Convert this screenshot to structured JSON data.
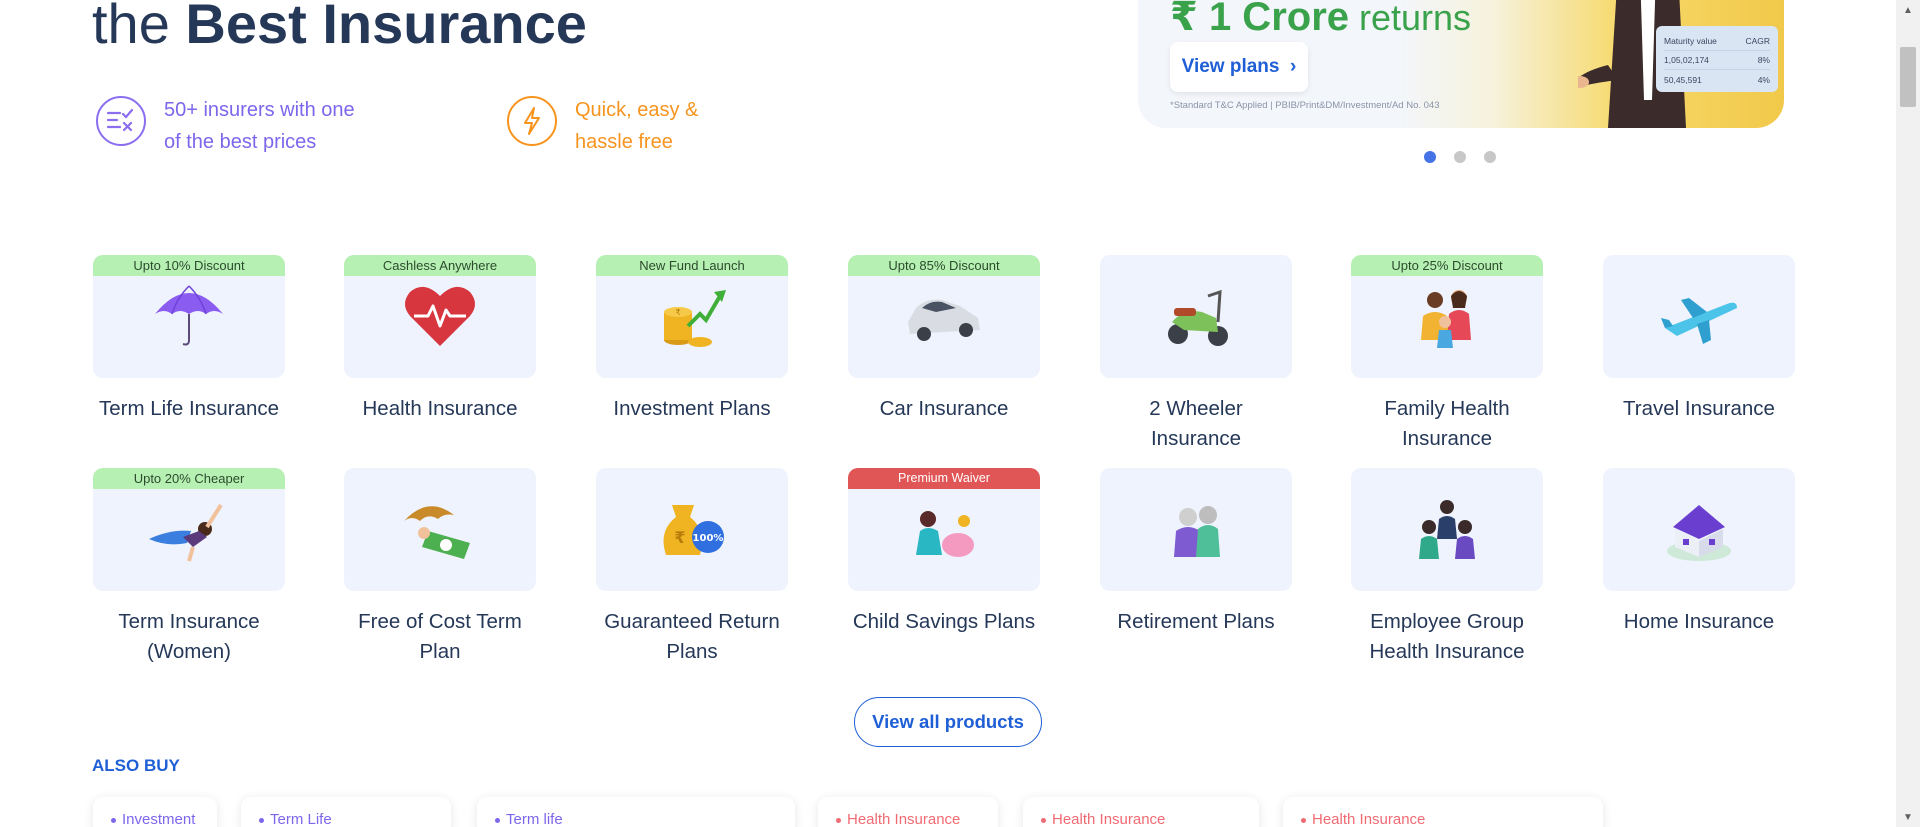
{
  "hero": {
    "title_prefix": "the ",
    "title_bold": "Best Insurance"
  },
  "features": [
    {
      "icon": "compare-check-icon",
      "line1": "50+ insurers with one",
      "line2": "of the best prices",
      "color": "#7e66ec"
    },
    {
      "icon": "lightning-icon",
      "line1": "Quick, easy &",
      "line2": "hassle free",
      "color": "#f7941d"
    }
  ],
  "banner": {
    "headline_bold": "₹ 1 Crore",
    "headline_rest": " returns",
    "button_label": "View plans",
    "button_arrow": "›",
    "note": "*Standard T&C Applied | PBIB/Print&DM/Investment/Ad No. 043",
    "table": {
      "headers": [
        "Maturity value",
        "CAGR"
      ],
      "rows": [
        [
          "1,05,02,174",
          "8%"
        ],
        [
          "50,45,591",
          "4%"
        ]
      ]
    }
  },
  "carousel": {
    "dots": 3,
    "active": 0
  },
  "products": [
    {
      "label": "Term Life Insurance",
      "tag": "Upto 10% Discount",
      "icon": "umbrella-icon"
    },
    {
      "label": "Health Insurance",
      "tag": "Cashless Anywhere",
      "icon": "heart-pulse-icon"
    },
    {
      "label": "Investment Plans",
      "tag": "New Fund Launch",
      "icon": "coins-growth-icon"
    },
    {
      "label": "Car Insurance",
      "tag": "Upto 85% Discount",
      "icon": "car-icon"
    },
    {
      "label": "2 Wheeler Insurance",
      "tag": "",
      "icon": "scooter-icon"
    },
    {
      "label": "Family Health Insurance",
      "tag": "Upto 25% Discount",
      "icon": "family-icon"
    },
    {
      "label": "Travel Insurance",
      "tag": "",
      "icon": "airplane-icon"
    },
    {
      "label": "Term Insurance (Women)",
      "tag": "Upto 20% Cheaper",
      "icon": "superwoman-icon"
    },
    {
      "label": "Free of Cost Term Plan",
      "tag": "",
      "icon": "umbrella-cash-icon"
    },
    {
      "label": "Guaranteed Return Plans",
      "tag": "",
      "icon": "money-bag-icon"
    },
    {
      "label": "Child Savings Plans",
      "tag": "Premium Waiver",
      "icon": "child-piggybank-icon"
    },
    {
      "label": "Retirement Plans",
      "tag": "",
      "icon": "elderly-couple-icon"
    },
    {
      "label": "Employee Group Health Insurance",
      "tag": "",
      "icon": "group-icon"
    },
    {
      "label": "Home Insurance",
      "tag": "",
      "icon": "house-icon"
    }
  ],
  "view_all_label": "View all products",
  "also_buy": {
    "heading": "ALSO BUY",
    "items": [
      {
        "label": "Investment",
        "color": "#7e66ec"
      },
      {
        "label": "Term Life",
        "color": "#7e66ec"
      },
      {
        "label": "Term life",
        "color": "#7e66ec"
      },
      {
        "label": "Health Insurance",
        "color": "#f06b73"
      },
      {
        "label": "Health Insurance",
        "color": "#f06b73"
      },
      {
        "label": "Health Insurance",
        "color": "#f06b73"
      }
    ]
  },
  "colors": {
    "primary": "#1f5fd6",
    "text": "#253858",
    "tag_green": "#b7f0b3",
    "tag_red": "#e05555",
    "card_bg": "#eef3fd"
  }
}
